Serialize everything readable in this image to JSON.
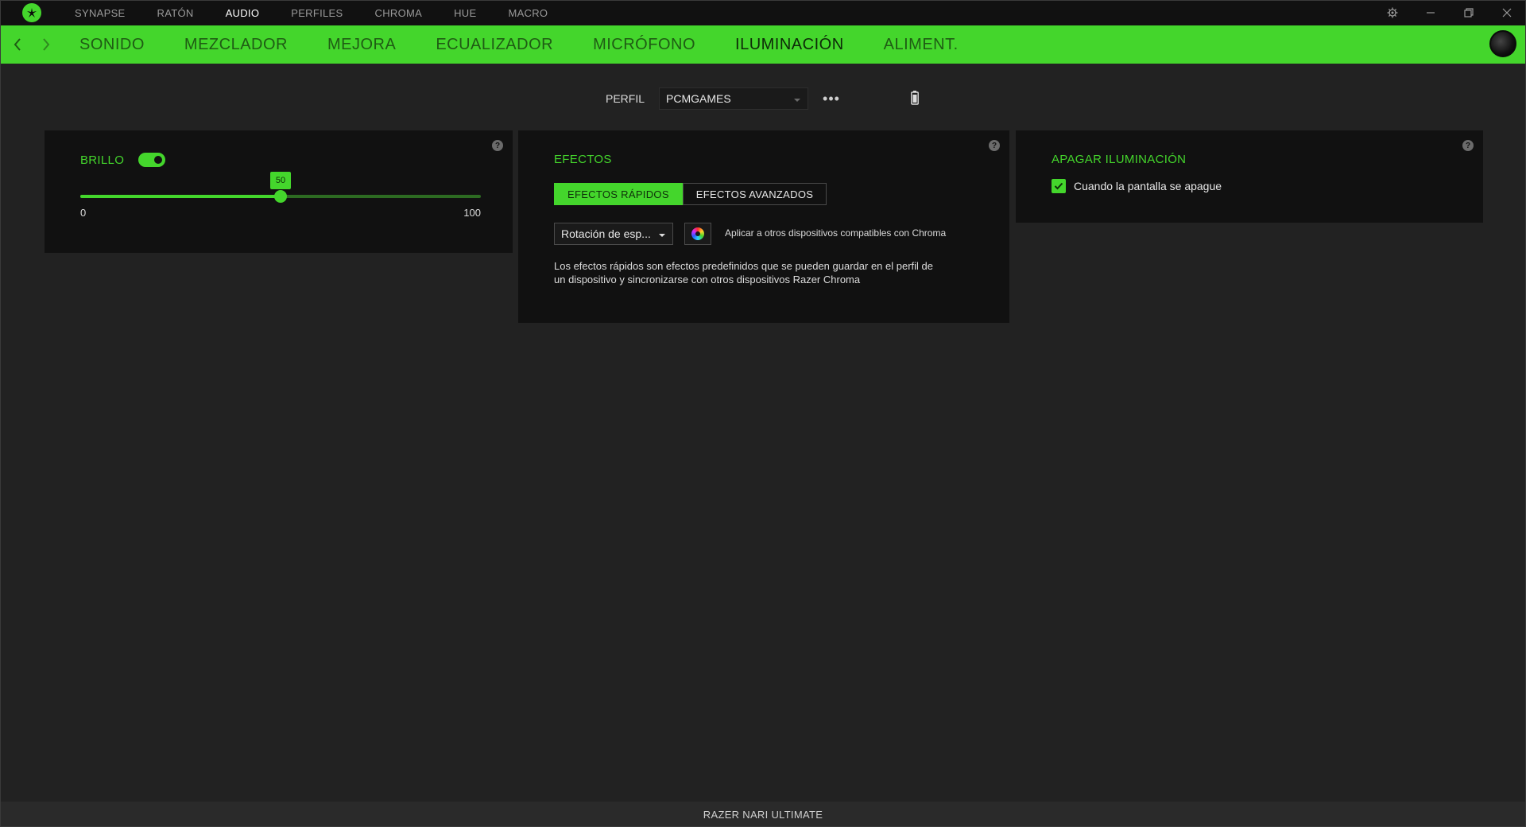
{
  "top_nav": {
    "items": [
      "SYNAPSE",
      "RATÓN",
      "AUDIO",
      "PERFILES",
      "CHROMA",
      "HUE",
      "MACRO"
    ],
    "active": "AUDIO"
  },
  "sub_nav": {
    "tabs": [
      "SONIDO",
      "MEZCLADOR",
      "MEJORA",
      "ECUALIZADOR",
      "MICRÓFONO",
      "ILUMINACIÓN",
      "ALIMENT."
    ],
    "active": "ILUMINACIÓN"
  },
  "profile": {
    "label": "PERFIL",
    "selected": "PCMGAMES",
    "more": "•••"
  },
  "brightness": {
    "title": "BRILLO",
    "enabled": true,
    "value": "50",
    "min": "0",
    "max": "100"
  },
  "effects": {
    "title": "EFECTOS",
    "tab_quick": "EFECTOS RÁPIDOS",
    "tab_advanced": "EFECTOS AVANZADOS",
    "selected_effect": "Rotación de esp...",
    "apply_text": "Aplicar a otros dispositivos compatibles con Chroma",
    "description": "Los efectos rápidos son efectos predefinidos que se pueden guardar en el perfil de un dispositivo y sincronizarse con otros dispositivos Razer Chroma"
  },
  "lights_off": {
    "title": "APAGAR ILUMINACIÓN",
    "option_label": "Cuando la pantalla se apague",
    "checked": true
  },
  "help_label": "?",
  "status": {
    "device": "RAZER NARI ULTIMATE"
  },
  "colors": {
    "accent": "#44d62c",
    "background": "#222222",
    "panel": "#111111"
  }
}
